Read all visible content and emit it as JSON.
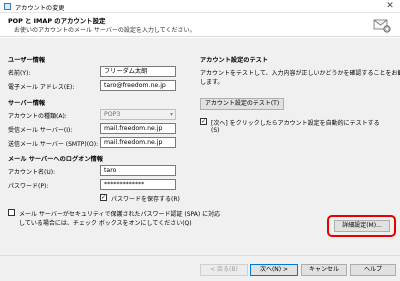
{
  "window": {
    "title": "アカウントの変更",
    "close_glyph": "✕"
  },
  "header": {
    "title": "POP と IMAP のアカウント設定",
    "subtitle": "お使いのアカウントのメール サーバーの設定を入力してください。"
  },
  "user_info": {
    "section_label": "ユーザー情報",
    "name_label": "名前(Y):",
    "name_value": "フリーダム太朗",
    "email_label": "電子メール アドレス(E):",
    "email_value": "taro@freedom.ne.jp"
  },
  "server_info": {
    "section_label": "サーバー情報",
    "account_type_label": "アカウントの種類(A):",
    "account_type_value": "POP3",
    "incoming_label": "受信メール サーバー(I):",
    "incoming_value": "mail.freedom.ne.jp",
    "outgoing_label": "送信メール サーバー (SMTP)(O):",
    "outgoing_value": "mail.freedom.ne.jp"
  },
  "logon_info": {
    "section_label": "メール サーバーへのログオン情報",
    "account_name_label": "アカウント名(U):",
    "account_name_value": "taro",
    "password_label": "パスワード(P):",
    "password_value": "*************",
    "save_password_label": "パスワードを保存する(R)",
    "save_password_checked": true
  },
  "spa": {
    "label_line1": "メール サーバーがセキュリティで保護されたパスワード認証 (SPA) に対応",
    "label_line2": "している場合には、チェック ボックスをオンにしてください(Q)",
    "checked": false
  },
  "test": {
    "section_label": "アカウント設定のテスト",
    "description_line1": "アカウントをテストして、入力内容が正しいかどうかを確認することをお勧め",
    "description_line2": "します。",
    "test_button_label": "アカウント設定のテスト(T)",
    "auto_test_line1": "[次へ] をクリックしたらアカウント設定を自動的にテストする",
    "auto_test_line2": "(S)",
    "auto_test_checked": true
  },
  "more_settings_button_label": "詳細設定(M)...",
  "footer": {
    "back_label": "< 戻る(B)",
    "next_label": "次へ(N) >",
    "cancel_label": "キャンセル",
    "help_label": "ヘルプ"
  },
  "colors": {
    "highlight": "#e60000",
    "focus_border": "#0078d7",
    "panel_bg": "#f0f0f0"
  },
  "icons": [
    "outlook-app-icon",
    "close-icon",
    "mail-settings-icon",
    "dropdown-chevron-icon",
    "checkmark-icon"
  ]
}
